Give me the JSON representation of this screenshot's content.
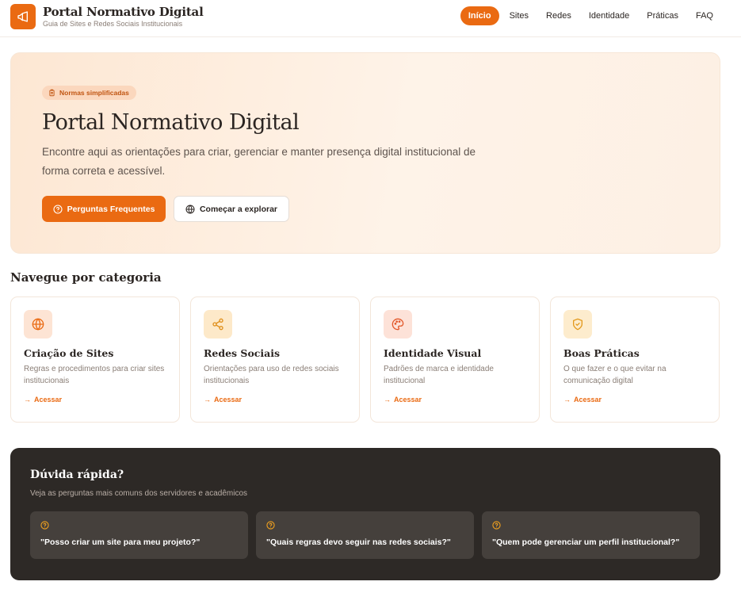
{
  "header": {
    "brand_title": "Portal Normativo Digital",
    "brand_subtitle": "Guia de Sites e Redes Sociais Institucionais",
    "nav": [
      "Início",
      "Sites",
      "Redes",
      "Identidade",
      "Práticas",
      "FAQ"
    ],
    "active_nav": "Início"
  },
  "hero": {
    "badge": "Normas simplificadas",
    "title": "Portal Normativo Digital",
    "description": "Encontre aqui as orientações para criar, gerenciar e manter presença digital institucional de forma correta e acessível.",
    "primary_button": "Perguntas Frequentes",
    "secondary_button": "Começar a explorar"
  },
  "categories": {
    "title": "Navegue por categoria",
    "items": [
      {
        "icon": "globe-icon",
        "title": "Criação de Sites",
        "description": "Regras e procedimentos para criar sites institucionais",
        "link": "Acessar"
      },
      {
        "icon": "share-icon",
        "title": "Redes Sociais",
        "description": "Orientações para uso de redes sociais institucionais",
        "link": "Acessar"
      },
      {
        "icon": "palette-icon",
        "title": "Identidade Visual",
        "description": "Padrões de marca e identidade institucional",
        "link": "Acessar"
      },
      {
        "icon": "shield-check-icon",
        "title": "Boas Práticas",
        "description": "O que fazer e o que evitar na comunicação digital",
        "link": "Acessar"
      }
    ]
  },
  "faq": {
    "title": "Dúvida rápida?",
    "subtitle": "Veja as perguntas mais comuns dos servidores e acadêmicos",
    "questions": [
      "\"Posso criar um site para meu projeto?\"",
      "\"Quais regras devo seguir nas redes sociais?\"",
      "\"Quem pode gerenciar um perfil institucional?\""
    ]
  },
  "colors": {
    "accent": "#ea6a12",
    "dark_panel": "#2d2926",
    "hero_bg": "#fde7d3"
  }
}
